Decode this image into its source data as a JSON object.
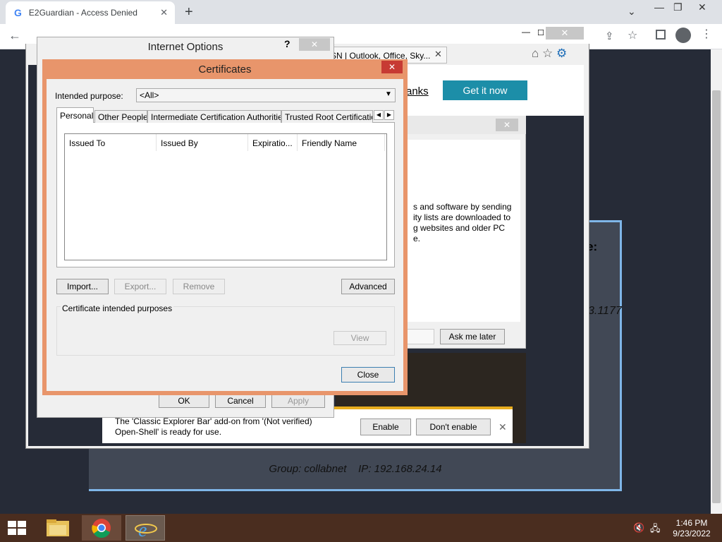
{
  "browser": {
    "tab_title": "E2Guardian - Access Denied",
    "tab_favicon": "G",
    "new_tab": "+",
    "close": "✕"
  },
  "page": {
    "group_line": "Group: collabnet    IP: 192.168.24.14",
    "ip_fragment": "3.1177",
    "heading_fragment": "e:"
  },
  "ie": {
    "tab_title": "SN | Outlook, Office, Sky...",
    "banner_link": "anks",
    "banner_button": "Get it now",
    "bg_dialog_text": "s and software by sending\nity lists are downloaded to\ng websites and older PC\ne.",
    "ask_later": "Ask me later",
    "addon_text": "The 'Classic Explorer Bar' add-on from '(Not verified)\nOpen-Shell' is ready for use.",
    "enable": "Enable",
    "dont_enable": "Don't enable"
  },
  "internet_options": {
    "title": "Internet Options",
    "help": "?",
    "ok": "OK",
    "cancel": "Cancel",
    "apply": "Apply"
  },
  "certificates": {
    "title": "Certificates",
    "intended_purpose_label": "Intended purpose:",
    "intended_purpose_value": "<All>",
    "tabs": [
      "Personal",
      "Other People",
      "Intermediate Certification Authorities",
      "Trusted Root Certification"
    ],
    "columns": [
      "Issued To",
      "Issued By",
      "Expiratio...",
      "Friendly Name"
    ],
    "buttons": {
      "import": "Import...",
      "export": "Export...",
      "remove": "Remove",
      "advanced": "Advanced",
      "view": "View",
      "close": "Close"
    },
    "purposes_group_label": "Certificate intended purposes"
  },
  "taskbar": {
    "time": "1:46 PM",
    "date": "9/23/2022"
  },
  "colors": {
    "cert_frame": "#e8956b",
    "cert_close": "#c73a33",
    "addon_accent": "#e8ad1e",
    "banner_button": "#1c8ea8",
    "taskbar": "#4a2d1f"
  }
}
